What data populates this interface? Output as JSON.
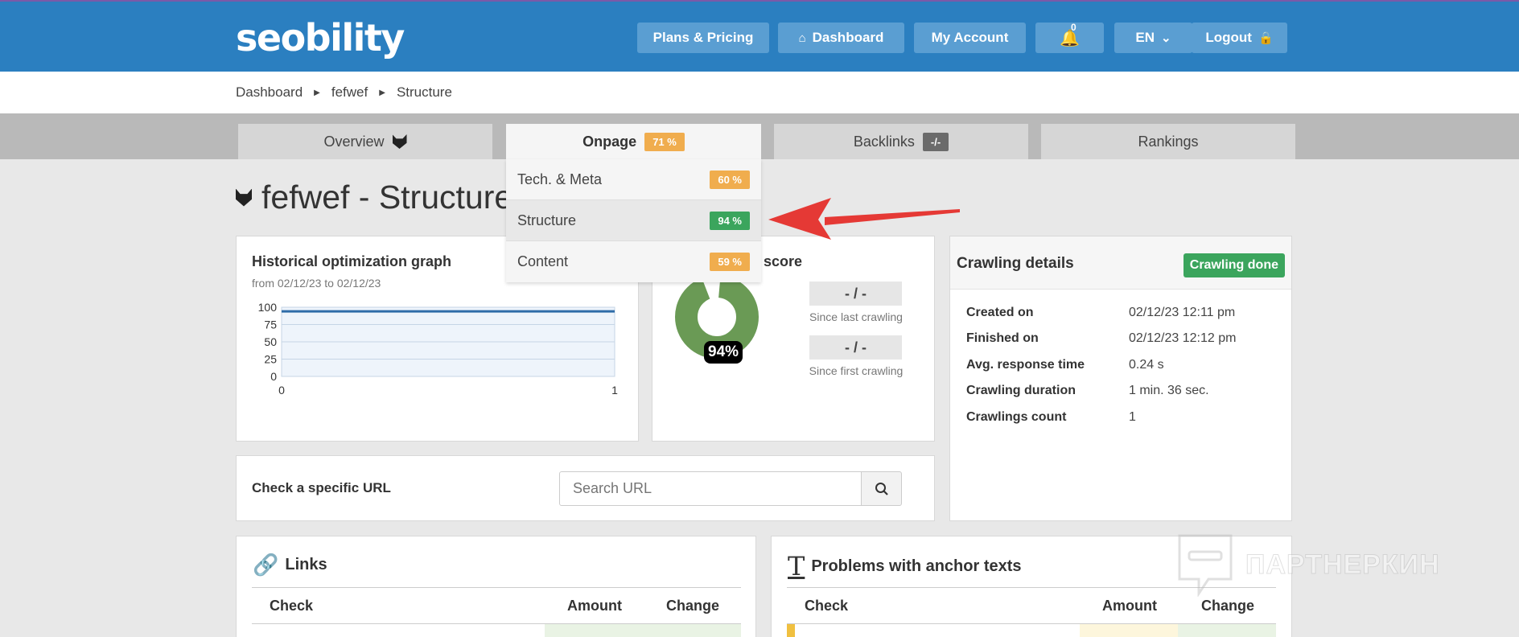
{
  "header": {
    "logo": "seobility",
    "nav": [
      {
        "label": "Plans & Pricing"
      },
      {
        "label": "Dashboard"
      },
      {
        "label": "My Account"
      },
      {
        "label": "0"
      },
      {
        "label": "EN"
      },
      {
        "label": "Logout"
      }
    ]
  },
  "breadcrumb": [
    "Dashboard",
    "fefwef",
    "Structure"
  ],
  "tabs": [
    {
      "label": "Overview"
    },
    {
      "label": "Onpage",
      "badge": "71 %"
    },
    {
      "label": "Backlinks",
      "badge": "-/-"
    },
    {
      "label": "Rankings"
    }
  ],
  "dropdown": [
    {
      "label": "Tech. & Meta",
      "badge": "60 %"
    },
    {
      "label": "Structure",
      "badge": "94 %"
    },
    {
      "label": "Content",
      "badge": "59 %"
    }
  ],
  "page": {
    "title": "fefwef - Structure"
  },
  "graph": {
    "title": "Historical optimization graph",
    "subtitle": "from 02/12/23 to 02/12/23",
    "y_ticks": [
      "100",
      "75",
      "50",
      "25",
      "0"
    ],
    "x_ticks": [
      "0",
      "1"
    ]
  },
  "chart_data": {
    "type": "line",
    "x": [
      0,
      1
    ],
    "series": [
      {
        "values": [
          94,
          94
        ]
      }
    ],
    "ylim": [
      0,
      100
    ],
    "xlim": [
      0,
      1
    ]
  },
  "score": {
    "title": "score",
    "percent": "94%",
    "value": 0.94,
    "since_last": "- / -",
    "since_last_caption": "Since last crawling",
    "since_first": "- / -",
    "since_first_caption": "Since first crawling"
  },
  "crawling": {
    "title": "Crawling details",
    "status": "Crawling done",
    "rows": [
      {
        "key": "Created on",
        "value": "02/12/23 12:11 pm"
      },
      {
        "key": "Finished on",
        "value": "02/12/23 12:12 pm"
      },
      {
        "key": "Avg. response time",
        "value": "0.24 s"
      },
      {
        "key": "Crawling duration",
        "value": "1 min. 36 sec."
      },
      {
        "key": "Crawlings count",
        "value": "1"
      }
    ]
  },
  "url_check": {
    "label": "Check a specific URL",
    "placeholder": "Search URL"
  },
  "links": {
    "title": "Links",
    "columns": [
      "Check",
      "Amount",
      "Change"
    ]
  },
  "anchor": {
    "title": "Problems with anchor texts",
    "columns": [
      "Check",
      "Amount",
      "Change"
    ]
  },
  "watermark": "ПАРТНЕРКИН",
  "colors": {
    "brand": "#2b7fc0",
    "green": "#3ba55d",
    "orange": "#f0ad4e",
    "donut": "#6a9a55"
  }
}
